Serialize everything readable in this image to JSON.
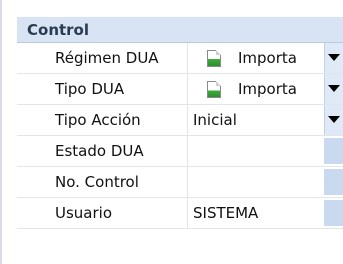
{
  "panel": {
    "title": "Control"
  },
  "rows": [
    {
      "label": "Régimen DUA",
      "value": "Importa",
      "has_doc_icon": true,
      "has_dropdown": true
    },
    {
      "label": "Tipo DUA",
      "value": "Importa",
      "has_doc_icon": true,
      "has_dropdown": true
    },
    {
      "label": "Tipo Acción",
      "value": "Inicial",
      "has_doc_icon": false,
      "has_dropdown": true
    },
    {
      "label": "Estado DUA",
      "value": "",
      "has_doc_icon": false,
      "has_dropdown": false
    },
    {
      "label": "No. Control",
      "value": "",
      "has_doc_icon": false,
      "has_dropdown": false
    },
    {
      "label": "Usuario",
      "value": "SISTEMA",
      "has_doc_icon": false,
      "has_dropdown": false
    }
  ],
  "icons": {
    "doc": "document-icon",
    "dropdown": "dropdown-arrow-icon"
  },
  "colors": {
    "header_bg": "#d8e4f3",
    "header_text": "#2b3b52",
    "dropdown_bg": "#dfe9f7"
  }
}
